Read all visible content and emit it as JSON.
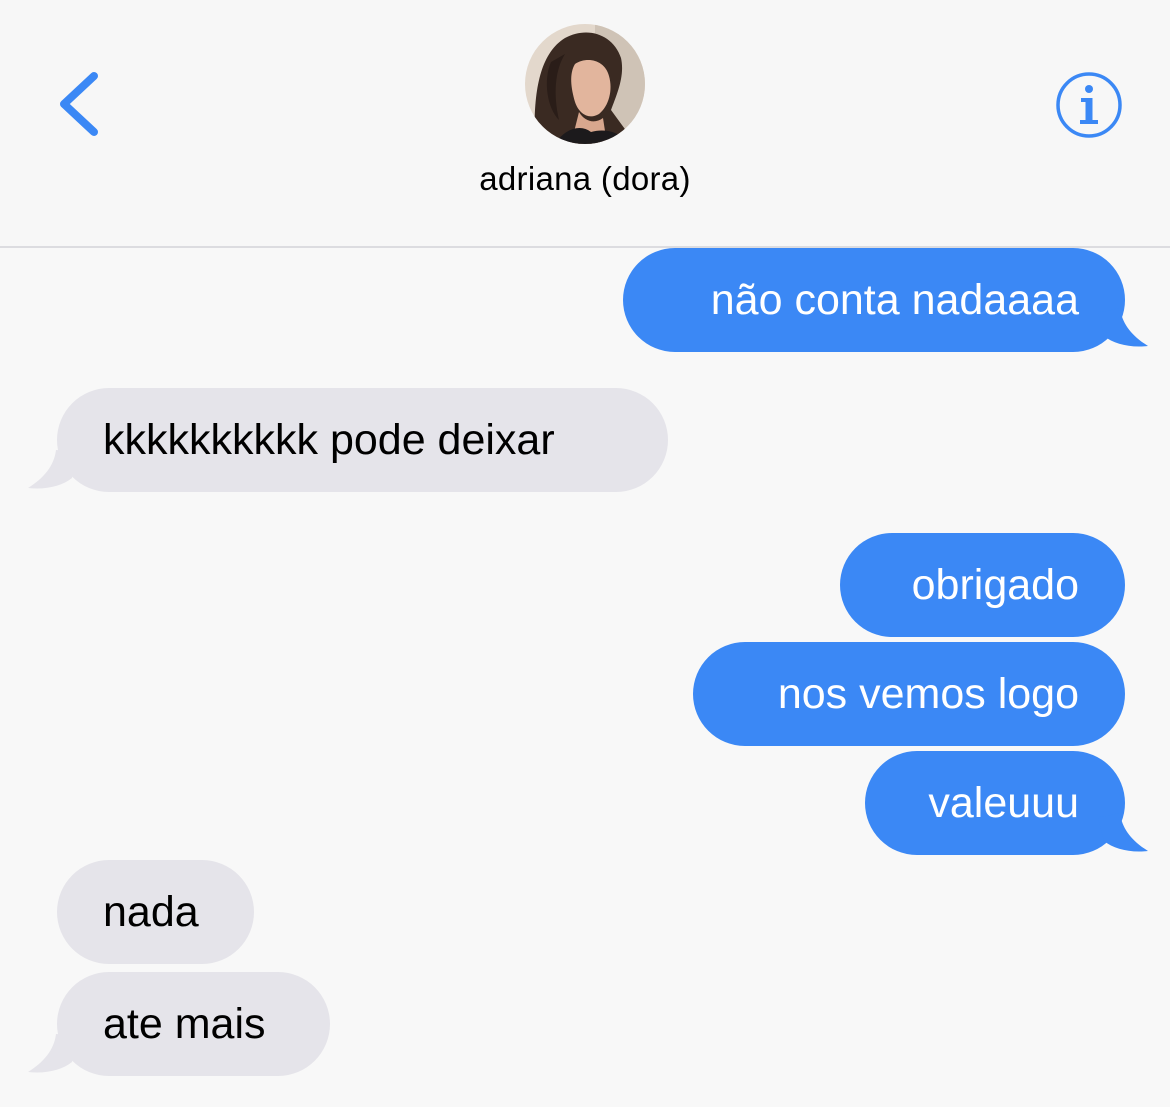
{
  "header": {
    "back_icon": "chevron-left-icon",
    "info_icon": "info-circle-icon",
    "contact_name": "adriana (dora)",
    "avatar": "contact-photo",
    "accent_color": "#3b88f5"
  },
  "messages": [
    {
      "direction": "sent",
      "text": "não conta nadaaaa"
    },
    {
      "direction": "received",
      "text": "kkkkkkkkkk pode deixar"
    },
    {
      "direction": "sent",
      "text": "obrigado"
    },
    {
      "direction": "sent",
      "text": "nos vemos logo"
    },
    {
      "direction": "sent",
      "text": "valeuuu"
    },
    {
      "direction": "received",
      "text": "nada"
    },
    {
      "direction": "received",
      "text": "ate mais"
    }
  ],
  "colors": {
    "sent_bubble": "#3b88f5",
    "received_bubble": "#e5e4ea",
    "background": "#f8f8f8"
  }
}
